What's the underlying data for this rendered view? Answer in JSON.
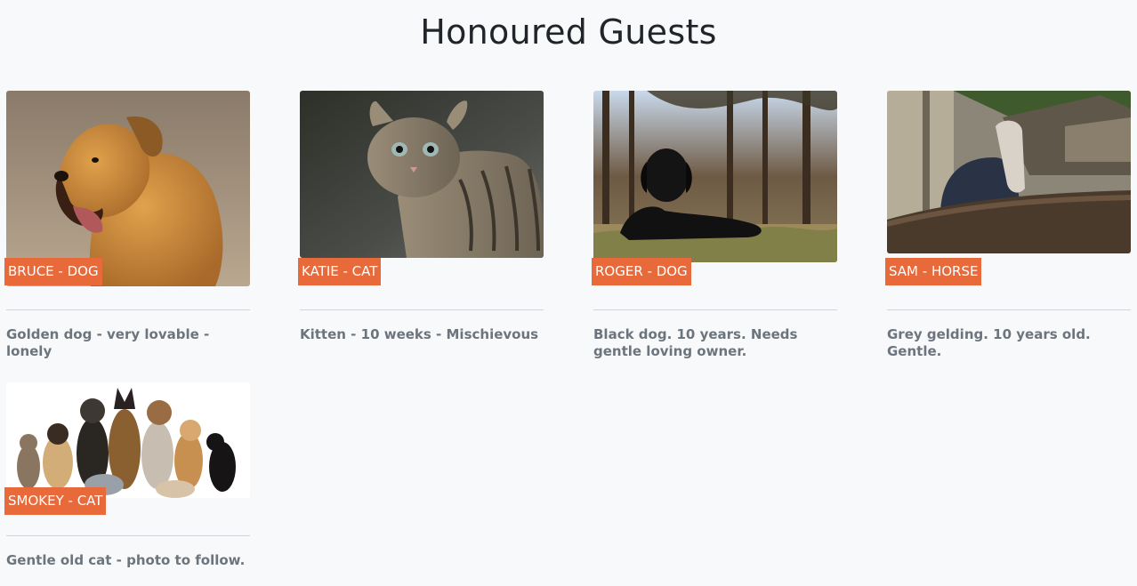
{
  "page": {
    "title": "Honoured Guests"
  },
  "guests": [
    {
      "tag": "BRUCE - DOG",
      "description": "Golden dog - very lovable - lonely",
      "photo_icon": "golden-dog-photo"
    },
    {
      "tag": "KATIE - CAT",
      "description": "Kitten - 10 weeks - Mischievous",
      "photo_icon": "tabby-kitten-photo"
    },
    {
      "tag": "ROGER - DOG",
      "description": "Black dog. 10 years. Needs gentle loving owner.",
      "photo_icon": "black-dog-photo"
    },
    {
      "tag": "SAM - HORSE",
      "description": "Grey gelding. 10 years old. Gentle.",
      "photo_icon": "grey-horse-photo"
    },
    {
      "tag": "SMOKEY - CAT",
      "description": "Gentle old cat - photo to follow.",
      "photo_icon": "group-of-pets-photo"
    }
  ],
  "colors": {
    "tag_background": "#e8693a",
    "page_background": "#f8f9fa",
    "description_text": "#6c757d"
  }
}
